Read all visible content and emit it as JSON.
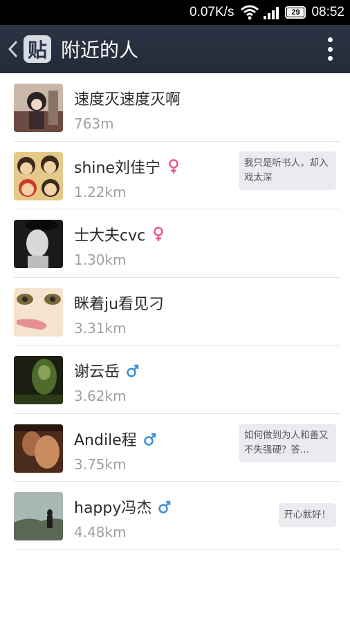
{
  "status_bar": {
    "net_speed": "0.07K/s",
    "battery_level": "29",
    "time": "08:52",
    "icons": [
      "wifi-icon",
      "signal-icon",
      "battery-icon"
    ]
  },
  "nav": {
    "back_icon": "chevron-left-icon",
    "logo_text": "贴",
    "title": "附近的人",
    "menu_icon": "more-vertical-icon"
  },
  "colors": {
    "nav_bg": "#262d3c",
    "female": "#e8588a",
    "male": "#3a8fd6",
    "distance": "#a0a0a0",
    "bubble_bg": "#e9ebf0"
  },
  "people": [
    {
      "name": "速度灭速度灭啊",
      "distance": "763m",
      "gender": "",
      "signature": ""
    },
    {
      "name": "shine刘佳宁",
      "distance": "1.22km",
      "gender": "female",
      "signature": "我只是听书人，却入戏太深"
    },
    {
      "name": "士大夫cvc",
      "distance": "1.30km",
      "gender": "female",
      "signature": ""
    },
    {
      "name": "眯着ju看见刁",
      "distance": "3.31km",
      "gender": "",
      "signature": ""
    },
    {
      "name": "谢云岳",
      "distance": "3.62km",
      "gender": "male",
      "signature": ""
    },
    {
      "name": "Andile程",
      "distance": "3.75km",
      "gender": "male",
      "signature": "如何做到为人和善又不失强硬？答..."
    },
    {
      "name": "happy冯杰",
      "distance": "4.48km",
      "gender": "male",
      "signature": "开心就好！"
    }
  ]
}
